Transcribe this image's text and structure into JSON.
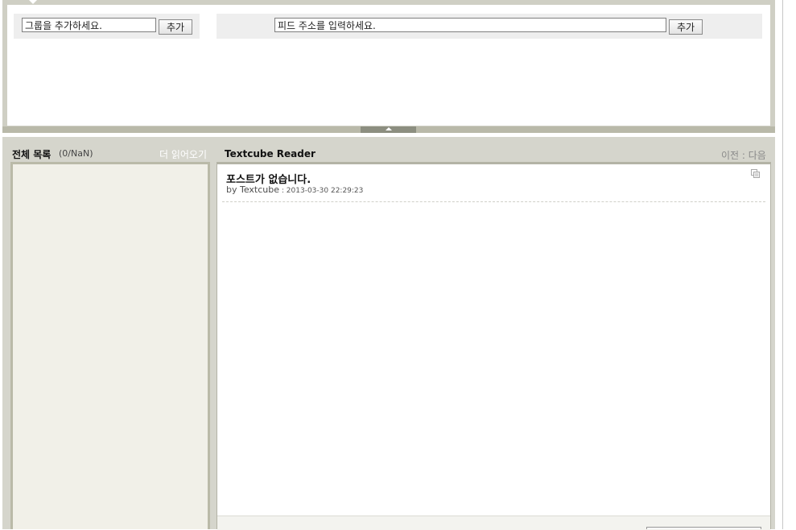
{
  "add_panel": {
    "group_input_value": "그룹을 추가하세요.",
    "group_add_label": "추가",
    "feed_input_value": "피드 주소를 입력하세요.",
    "feed_add_label": "추가"
  },
  "list": {
    "title": "전체 목록",
    "count": "(0/NaN)",
    "load_more": "더 읽어오기"
  },
  "reader": {
    "title": "Textcube Reader",
    "prev": "이전",
    "separator": " : ",
    "next": "다음"
  },
  "post": {
    "title": "포스트가 없습니다.",
    "by": "by ",
    "author": "Textcube",
    "date_sep": " : ",
    "date": "2013-03-30 22:29:23"
  },
  "colors": {
    "panel_border": "#cfcfc4",
    "reader_background": "#d5d5cc",
    "list_background": "#f1f0e8"
  },
  "icons": {
    "post_action": "copy-icon",
    "collapse": "triangle-up-icon"
  }
}
